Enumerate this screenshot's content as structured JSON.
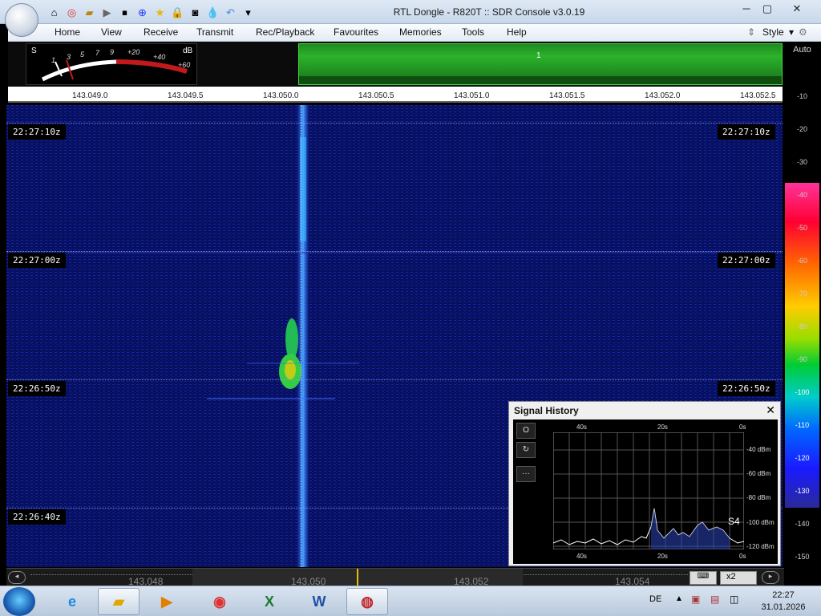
{
  "window": {
    "title": "RTL Dongle - R820T :: SDR Console v3.0.19",
    "controls": [
      "─",
      "▢",
      "✕"
    ]
  },
  "quick_access": [
    "home-icon",
    "lifebuoy-icon",
    "folder-icon",
    "play-icon",
    "stop-icon",
    "plus-icon",
    "star-icon",
    "lock-icon",
    "camera-icon",
    "drop-icon",
    "undo-icon",
    "dropdown-icon"
  ],
  "menu": {
    "items": [
      "Home",
      "View",
      "Receive",
      "Transmit",
      "Rec/Playback",
      "Favourites",
      "Memories",
      "Tools",
      "Help"
    ],
    "style_label": "Style"
  },
  "smeter": {
    "s_label": "S",
    "db_label": "dB",
    "scale": [
      "1",
      "3",
      "5",
      "7",
      "9",
      "+20",
      "+40",
      "+60"
    ]
  },
  "spectrum": {
    "marker_label": "1"
  },
  "freq_axis": {
    "ticks": [
      "143.049.0",
      "143.049.5",
      "143.050.0",
      "143.050.5",
      "143.051.0",
      "143.051.5",
      "143.052.0",
      "143.052.5"
    ]
  },
  "waterfall": {
    "times": [
      "22:27:10z",
      "22:27:00z",
      "22:26:50z",
      "22:26:40z"
    ]
  },
  "db_scale": {
    "auto_label": "Auto",
    "labels": [
      "-10",
      "-20",
      "-30",
      "-40",
      "-50",
      "-60",
      "-70",
      "-80",
      "-90",
      "-100",
      "-110",
      "-120",
      "-130",
      "-140",
      "-150"
    ]
  },
  "bottom_bar": {
    "freqs": [
      "143.048",
      "143.050",
      "143.052",
      "143.054"
    ],
    "zoom_label": "x2"
  },
  "signal_history": {
    "title": "Signal History",
    "time_top": [
      "40s",
      "20s",
      "0s"
    ],
    "time_bottom": [
      "40s",
      "20s",
      "0s"
    ],
    "dbm_labels": [
      "-40 dBm",
      "-60 dBm",
      "-80 dBm",
      "-100 dBm",
      "-120 dBm"
    ],
    "s_reading": "S4",
    "buttons": [
      "O",
      "↻",
      "···"
    ]
  },
  "taskbar": {
    "apps": [
      "ie-icon",
      "explorer-icon",
      "media-icon",
      "chrome-icon",
      "excel-icon",
      "word-icon",
      "sdr-icon"
    ],
    "lang": "DE",
    "time": "22:27",
    "date": "31.01.2026"
  },
  "colors": {
    "waterfall_bg": "#0a1060",
    "spectrum_green": "#2bb32b",
    "signal": "#3aa6ff"
  }
}
